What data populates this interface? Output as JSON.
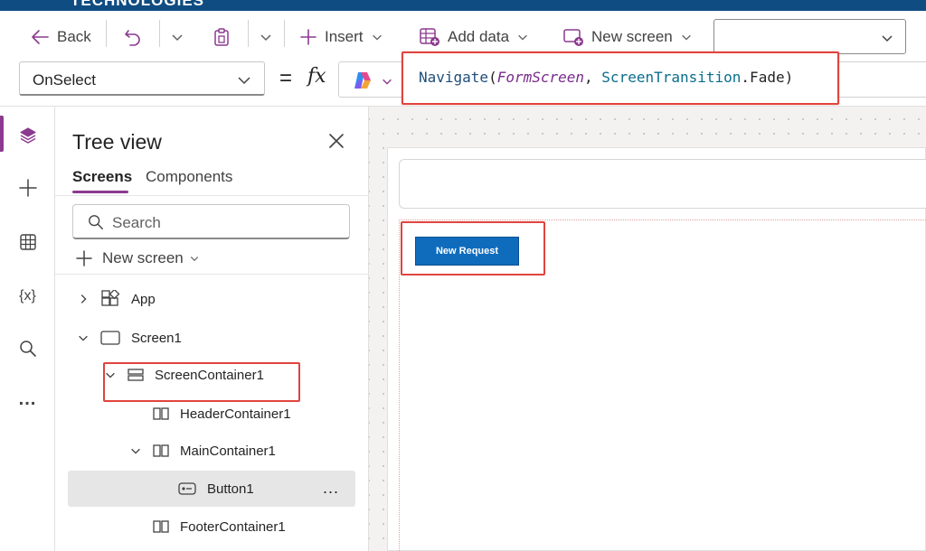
{
  "brand": {
    "text": "TECHNOLOGIES"
  },
  "toolbar": {
    "back_label": "Back",
    "insert_label": "Insert",
    "add_data_label": "Add data",
    "new_screen_label": "New screen",
    "screen_selector_value": ""
  },
  "formula_bar": {
    "property": "OnSelect",
    "equals": "=",
    "fx": "fx",
    "formula": {
      "fn": "Navigate",
      "open": "(",
      "arg1": "FormScreen",
      "comma": ", ",
      "enum_type": "ScreenTransition",
      "dot_member": ".Fade",
      "close": ")"
    }
  },
  "left_rail": {
    "items": [
      "tree-view",
      "insert",
      "data",
      "variables",
      "search",
      "more"
    ],
    "variables_label": "{x}",
    "more_label": "..."
  },
  "tree_view": {
    "title": "Tree view",
    "tabs": [
      "Screens",
      "Components"
    ],
    "search_placeholder": "Search",
    "new_screen_label": "New screen",
    "nodes": [
      {
        "label": "App"
      },
      {
        "label": "Screen1"
      },
      {
        "label": "ScreenContainer1"
      },
      {
        "label": "HeaderContainer1"
      },
      {
        "label": "MainContainer1"
      },
      {
        "label": "Button1"
      },
      {
        "label": "FooterContainer1"
      }
    ],
    "more_label": "..."
  },
  "canvas": {
    "button_text": "New Request"
  },
  "colors": {
    "accent": "#8b3a8f",
    "highlight": "#e0443e",
    "button": "#0f6cbd",
    "brand": "#0f4c81"
  }
}
